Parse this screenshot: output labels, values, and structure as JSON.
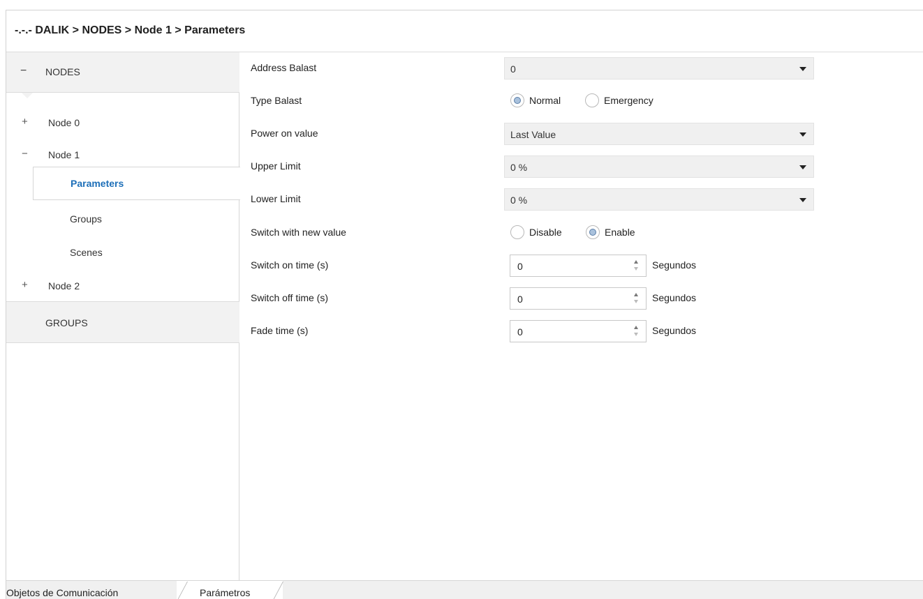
{
  "breadcrumb": "-.-.- DALIK > NODES > Node 1 > Parameters",
  "sidebar": {
    "nodes_header": {
      "symbol": "−",
      "label": "NODES"
    },
    "items": [
      {
        "symbol": "+",
        "label": "Node 0"
      },
      {
        "symbol": "−",
        "label": "Node 1"
      },
      {
        "symbol": "",
        "label": "Parameters",
        "selected": true
      },
      {
        "symbol": "",
        "label": "Groups"
      },
      {
        "symbol": "",
        "label": "Scenes"
      },
      {
        "symbol": "+",
        "label": "Node 2"
      }
    ],
    "groups_header": {
      "label": "GROUPS"
    }
  },
  "params": {
    "address_balast": {
      "label": "Address Balast",
      "value": "0"
    },
    "type_balast": {
      "label": "Type Balast",
      "options": [
        "Normal",
        "Emergency"
      ],
      "selected": "Normal"
    },
    "power_on_value": {
      "label": "Power on value",
      "value": "Last Value"
    },
    "upper_limit": {
      "label": "Upper Limit",
      "value": "0 %"
    },
    "lower_limit": {
      "label": "Lower Limit",
      "value": "0 %"
    },
    "switch_new_value": {
      "label": "Switch with new value",
      "options": [
        "Disable",
        "Enable"
      ],
      "selected": "Enable"
    },
    "switch_on_time": {
      "label": "Switch on time (s)",
      "value": "0",
      "unit": "Segundos"
    },
    "switch_off_time": {
      "label": "Switch off time (s)",
      "value": "0",
      "unit": "Segundos"
    },
    "fade_time": {
      "label": "Fade time (s)",
      "value": "0",
      "unit": "Segundos"
    }
  },
  "tabs": [
    {
      "label": "Objetos de Comunicación",
      "active": false
    },
    {
      "label": "Parámetros",
      "active": true
    }
  ],
  "colors": {
    "accent": "#1d6fb8",
    "radio_fill": "#a9c1dc",
    "control_bg": "#f0f0f0"
  }
}
